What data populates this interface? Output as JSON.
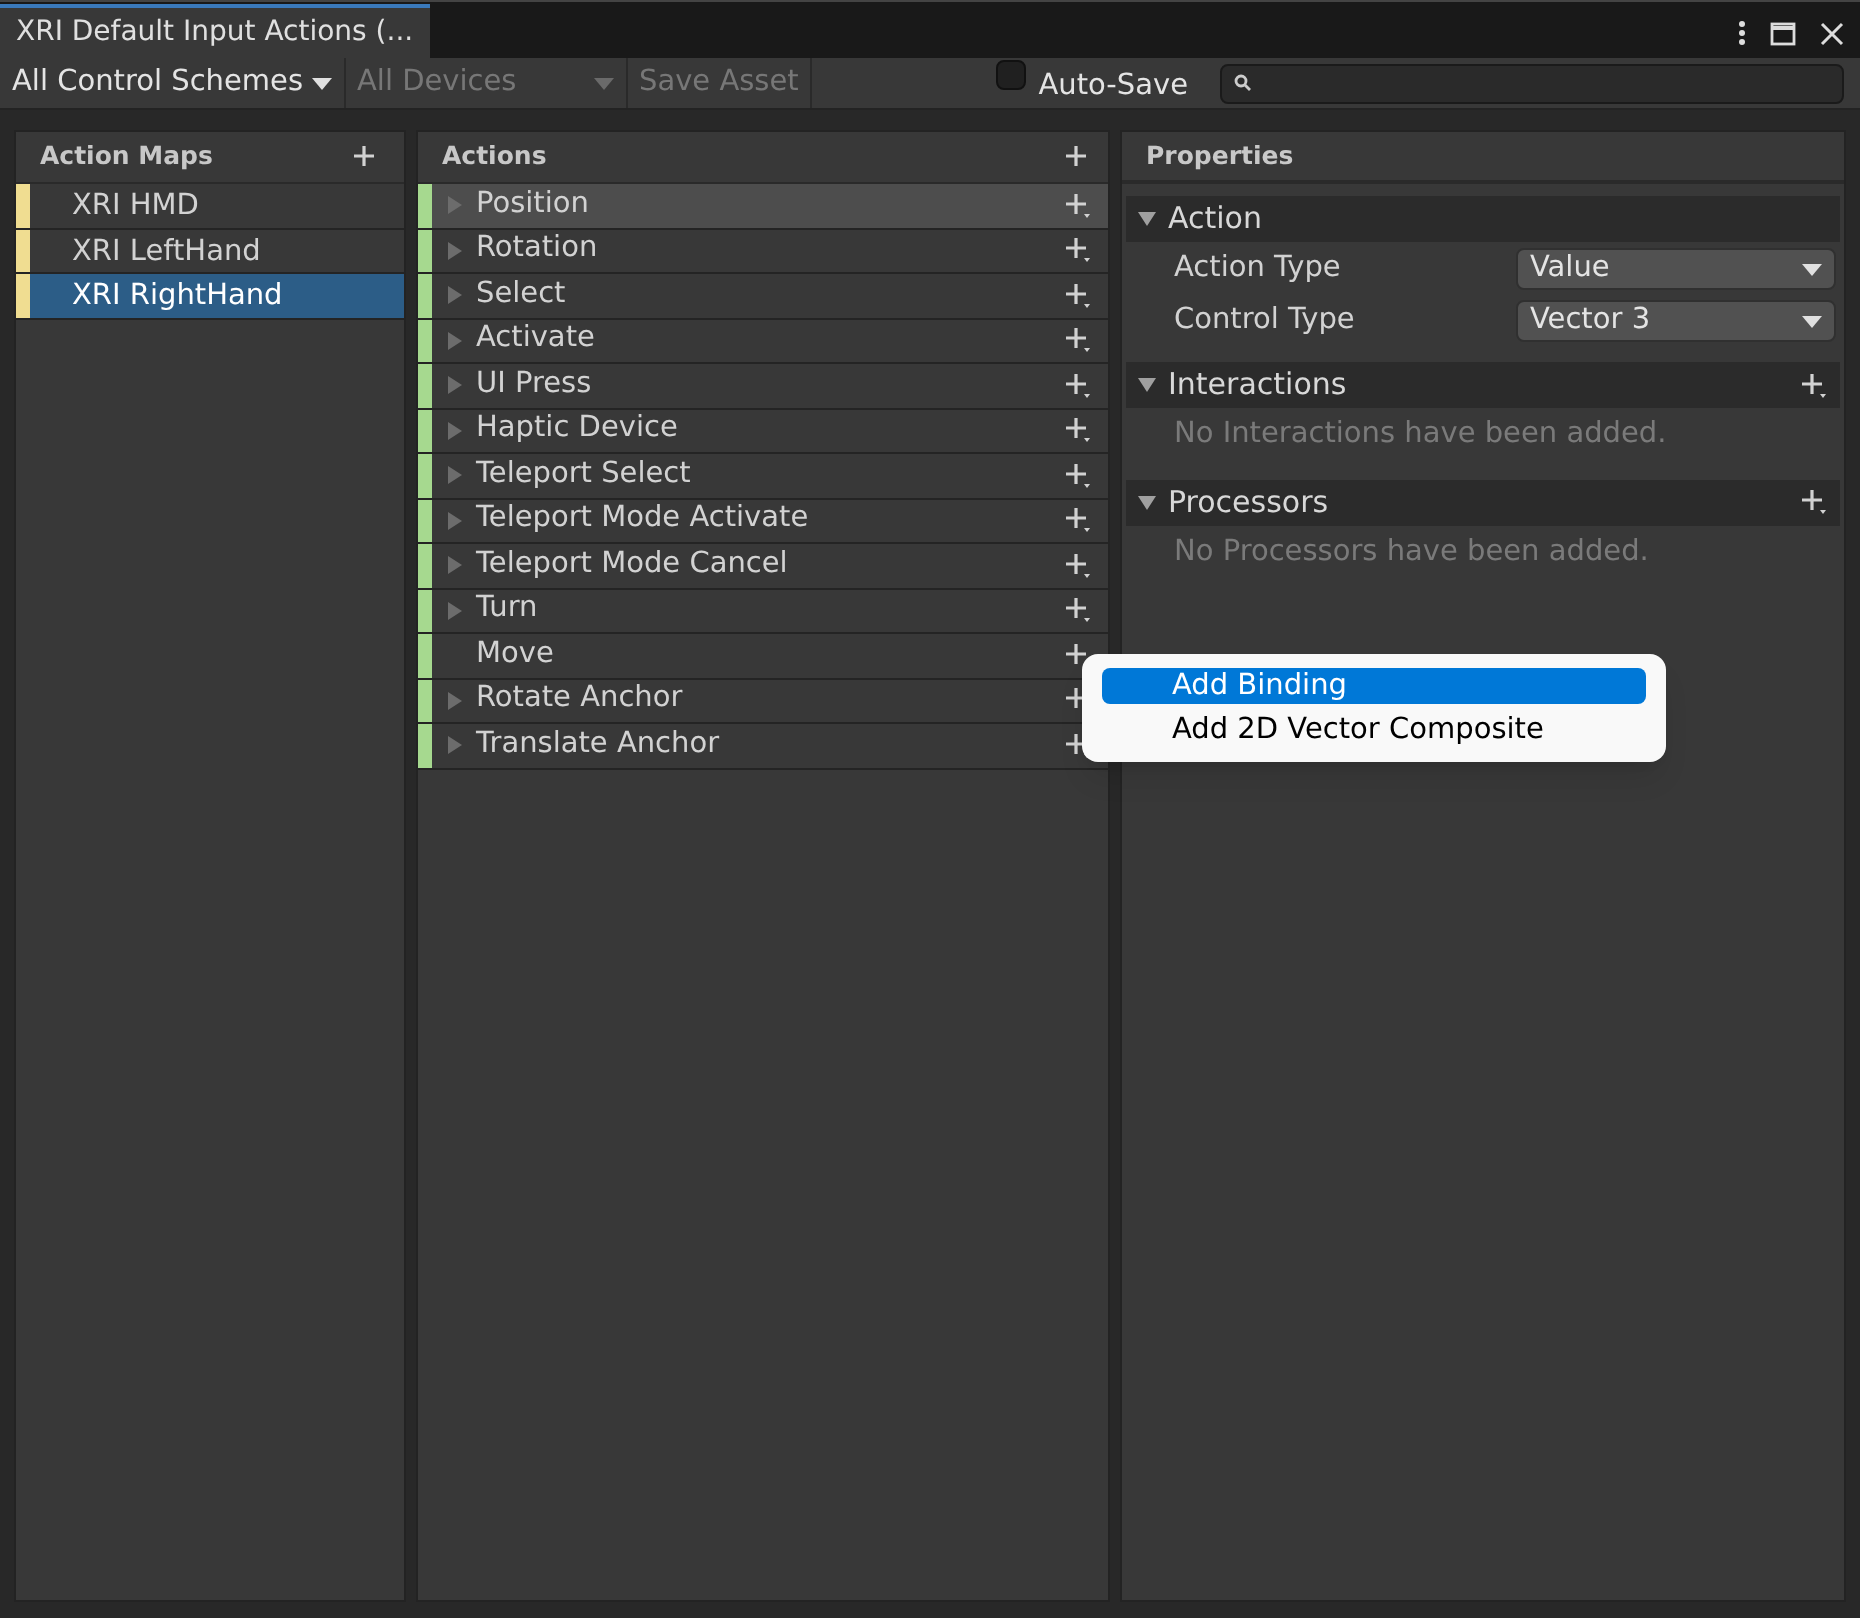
{
  "window": {
    "title": "XRI Default Input Actions (..."
  },
  "toolbar": {
    "control_schemes": {
      "label": "All Control Schemes",
      "disabled": false
    },
    "devices": {
      "label": "All Devices",
      "disabled": true
    },
    "save_asset": {
      "label": "Save Asset",
      "disabled": true
    },
    "auto_save": {
      "label": "Auto-Save",
      "checked": false
    }
  },
  "action_maps": {
    "title": "Action Maps",
    "items": [
      {
        "label": "XRI HMD",
        "selected": false
      },
      {
        "label": "XRI LeftHand",
        "selected": false
      },
      {
        "label": "XRI RightHand",
        "selected": true
      }
    ]
  },
  "actions": {
    "title": "Actions",
    "items": [
      {
        "label": "Position",
        "selected": true,
        "expandable": true
      },
      {
        "label": "Rotation",
        "selected": false,
        "expandable": true
      },
      {
        "label": "Select",
        "selected": false,
        "expandable": true
      },
      {
        "label": "Activate",
        "selected": false,
        "expandable": true
      },
      {
        "label": "UI Press",
        "selected": false,
        "expandable": true
      },
      {
        "label": "Haptic Device",
        "selected": false,
        "expandable": true
      },
      {
        "label": "Teleport Select",
        "selected": false,
        "expandable": true
      },
      {
        "label": "Teleport Mode Activate",
        "selected": false,
        "expandable": true
      },
      {
        "label": "Teleport Mode Cancel",
        "selected": false,
        "expandable": true
      },
      {
        "label": "Turn",
        "selected": false,
        "expandable": true
      },
      {
        "label": "Move",
        "selected": false,
        "expandable": false
      },
      {
        "label": "Rotate Anchor",
        "selected": false,
        "expandable": true
      },
      {
        "label": "Translate Anchor",
        "selected": false,
        "expandable": true
      }
    ]
  },
  "properties": {
    "title": "Properties",
    "sections": [
      {
        "title": "Action",
        "kind": "fields",
        "fields": [
          {
            "label": "Action Type",
            "value": "Value"
          },
          {
            "label": "Control Type",
            "value": "Vector 3"
          }
        ]
      },
      {
        "title": "Interactions",
        "kind": "empty",
        "message": "No Interactions have been added."
      },
      {
        "title": "Processors",
        "kind": "empty",
        "message": "No Processors have been added."
      }
    ]
  },
  "context_menu": {
    "items": [
      {
        "label": "Add Binding",
        "selected": true
      },
      {
        "label": "Add 2D Vector Composite",
        "selected": false
      }
    ]
  }
}
